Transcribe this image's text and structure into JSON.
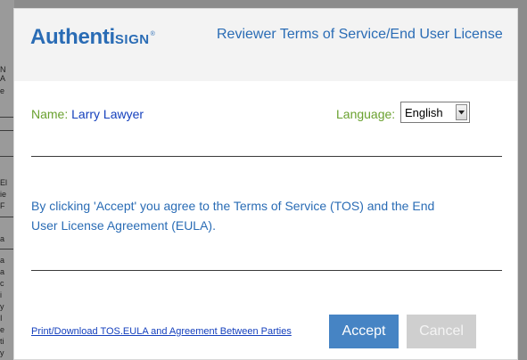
{
  "background": {
    "fragments": [
      "N",
      "A",
      "e",
      "El",
      "ie",
      "F",
      "a",
      "a",
      "a",
      "c",
      "i",
      "y",
      "I",
      "e",
      "ti",
      "y"
    ]
  },
  "header": {
    "logo_main": "Authenti",
    "logo_small": "SIGN",
    "logo_tm": "®",
    "title": "Reviewer Terms of Service/End User License"
  },
  "form": {
    "name_label": "Name:",
    "name_value": "Larry Lawyer",
    "language_label": "Language:",
    "language_selected": "English"
  },
  "agreement": {
    "text": "By clicking 'Accept' you agree to the Terms of Service (TOS) and the End User License Agreement (EULA)."
  },
  "footer": {
    "print_link": "Print/Download TOS.EULA and Agreement Between Parties",
    "accept_label": "Accept",
    "cancel_label": "Cancel"
  },
  "colors": {
    "brand_blue": "#2a6cb5",
    "label_green": "#6aa12f",
    "value_blue": "#1540bd",
    "accept_bg": "#4684c4",
    "cancel_bg": "#cfcfcf",
    "overlay": "#8c8c8c"
  }
}
